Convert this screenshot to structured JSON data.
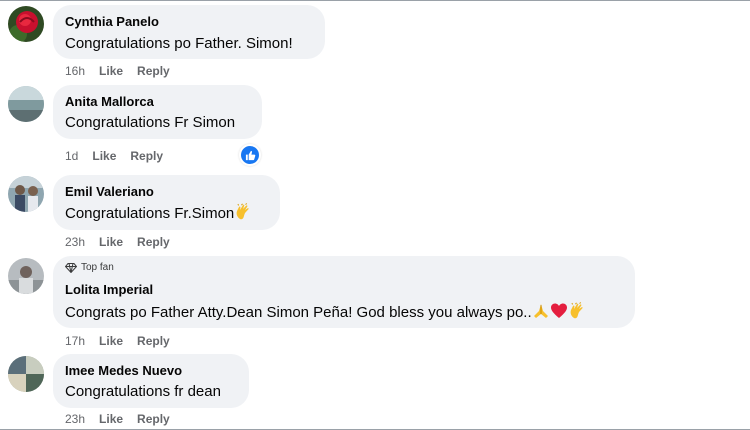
{
  "comments": [
    {
      "name": "Cynthia Panelo",
      "text": "Congratulations po Father. Simon!",
      "time": "16h",
      "like": "Like",
      "reply": "Reply"
    },
    {
      "name": "Anita Mallorca",
      "text": "Congratulations Fr Simon",
      "time": "1d",
      "like": "Like",
      "reply": "Reply",
      "reaction": "like-reaction-icon"
    },
    {
      "name": "Emil Valeriano",
      "text": "Congratulations Fr.Simon",
      "time": "23h",
      "like": "Like",
      "reply": "Reply",
      "emoji": "clapping-hands-icon"
    },
    {
      "badge": "Top fan",
      "name": "Lolita Imperial",
      "text": "Congrats po Father Atty.Dean Simon Peña! God bless you always po..",
      "time": "17h",
      "like": "Like",
      "reply": "Reply",
      "emojis": [
        "folded-hands-icon",
        "red-heart-icon",
        "clapping-hands-icon"
      ]
    },
    {
      "name": "Imee Medes Nuevo",
      "text": "Congratulations fr dean",
      "time": "23h",
      "like": "Like",
      "reply": "Reply"
    }
  ],
  "colors": {
    "bubble": "#f0f2f5",
    "meta": "#65676b",
    "like_blue": "#1877f2",
    "heart": "#e41e3f",
    "clap": "#f7c02d"
  }
}
